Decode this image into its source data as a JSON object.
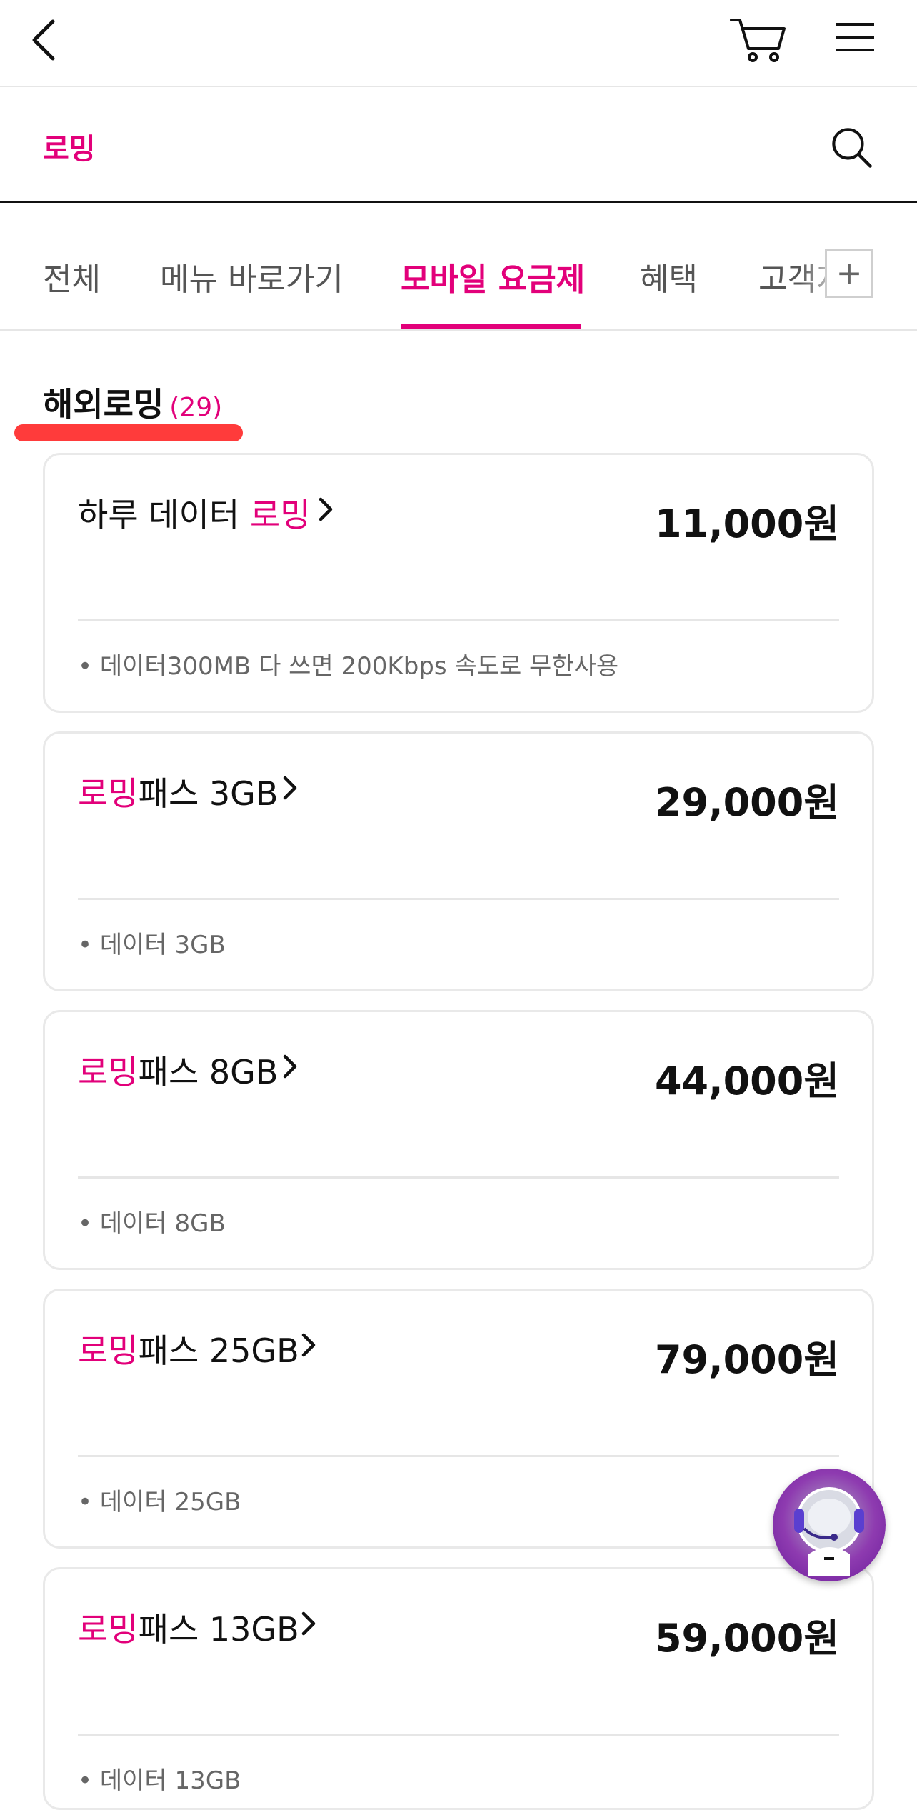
{
  "search": {
    "query": "로밍"
  },
  "tabs": [
    {
      "label": "전체"
    },
    {
      "label": "메뉴 바로가기"
    },
    {
      "label": "모바일 요금제",
      "active": true
    },
    {
      "label": "혜택"
    },
    {
      "label": "고객지원"
    }
  ],
  "section": {
    "title": "해외로밍",
    "count": "(29)"
  },
  "cards": [
    {
      "name_pre": "하루 데이터 ",
      "name_hl": "로밍",
      "name_post": "",
      "price": "11,000원",
      "desc": "• 데이터300MB 다 쓰면 200Kbps 속도로 무한사용"
    },
    {
      "name_pre": "",
      "name_hl": "로밍",
      "name_post": "패스 3GB",
      "price": "29,000원",
      "desc": "• 데이터 3GB"
    },
    {
      "name_pre": "",
      "name_hl": "로밍",
      "name_post": "패스 8GB",
      "price": "44,000원",
      "desc": "• 데이터 8GB"
    },
    {
      "name_pre": "",
      "name_hl": "로밍",
      "name_post": "패스 25GB",
      "price": "79,000원",
      "desc": "• 데이터 25GB"
    },
    {
      "name_pre": "",
      "name_hl": "로밍",
      "name_post": "패스 13GB",
      "price": "59,000원",
      "desc": "• 데이터 13GB"
    }
  ],
  "colors": {
    "brand": "#e2007a",
    "highlight": "#ff3b3b"
  },
  "icons": [
    "back-arrow-icon",
    "cart-icon",
    "hamburger-menu-icon",
    "search-icon",
    "plus-icon",
    "chevron-right-icon",
    "chatbot-avatar-icon"
  ]
}
